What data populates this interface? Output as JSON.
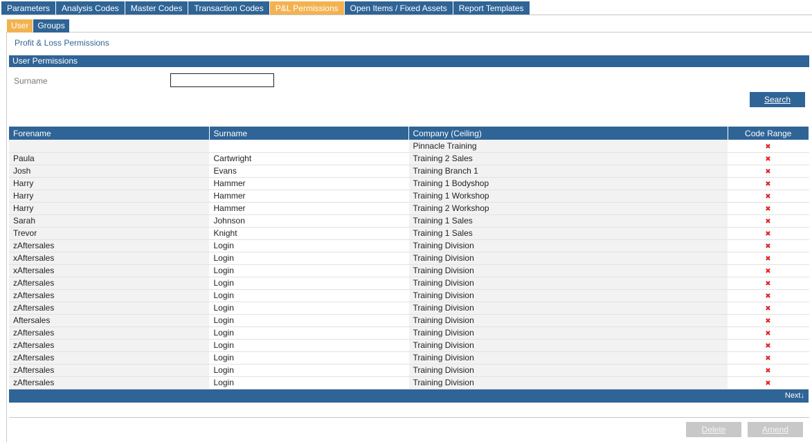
{
  "top_tabs": [
    {
      "label": "Parameters"
    },
    {
      "label": "Analysis Codes"
    },
    {
      "label": "Master Codes"
    },
    {
      "label": "Transaction Codes"
    },
    {
      "label": "P&L Permissions",
      "active": true
    },
    {
      "label": "Open Items / Fixed Assets"
    },
    {
      "label": "Report Templates"
    }
  ],
  "sub_tabs": [
    {
      "label": "User",
      "active": true
    },
    {
      "label": "Groups"
    }
  ],
  "page_title": "Profit & Loss Permissions",
  "section_title": "User Permissions",
  "search": {
    "label": "Surname",
    "value": "",
    "button_label": "Search"
  },
  "grid": {
    "columns": [
      "Forename",
      "Surname",
      "Company (Ceiling)",
      "Code Range"
    ],
    "rows": [
      [
        "",
        "",
        "Pinnacle Training"
      ],
      [
        "Paula",
        "Cartwright",
        "Training 2 Sales"
      ],
      [
        "Josh",
        "Evans",
        "Training Branch 1"
      ],
      [
        "Harry",
        "Hammer",
        "Training 1 Bodyshop"
      ],
      [
        "Harry",
        "Hammer",
        "Training 1 Workshop"
      ],
      [
        "Harry",
        "Hammer",
        "Training 2 Workshop"
      ],
      [
        "Sarah",
        "Johnson",
        "Training 1 Sales"
      ],
      [
        "Trevor",
        "Knight",
        "Training 1 Sales"
      ],
      [
        "zAftersales",
        "Login",
        "Training Division"
      ],
      [
        "xAftersales",
        "Login",
        "Training Division"
      ],
      [
        "xAftersales",
        "Login",
        "Training Division"
      ],
      [
        "zAftersales",
        "Login",
        "Training Division"
      ],
      [
        "zAftersales",
        "Login",
        "Training Division"
      ],
      [
        "zAftersales",
        "Login",
        "Training Division"
      ],
      [
        "Aftersales",
        "Login",
        "Training Division"
      ],
      [
        "zAftersales",
        "Login",
        "Training Division"
      ],
      [
        "zAftersales",
        "Login",
        "Training Division"
      ],
      [
        "zAftersales",
        "Login",
        "Training Division"
      ],
      [
        "zAftersales",
        "Login",
        "Training Division"
      ],
      [
        "zAftersales",
        "Login",
        "Training Division"
      ]
    ],
    "code_range_icon": "remove-x-icon",
    "code_range_glyph": "✖",
    "next_label": "Next",
    "next_icon": "arrow-down-icon",
    "next_glyph": "↓"
  },
  "buttons": {
    "delete_label": "Delete",
    "amend_label": "Amend"
  },
  "colors": {
    "primary": "#2f6496",
    "active_tab": "#f3b250",
    "remove_icon": "#e02020",
    "disabled_button": "#c8c8c8"
  }
}
